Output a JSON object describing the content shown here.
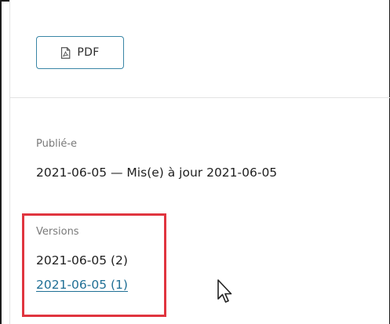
{
  "toolbar": {
    "pdf_label": "PDF",
    "pdf_icon": "pdf-document-icon"
  },
  "metadata": {
    "published_label": "Publié-e",
    "published_value": "2021-06-05 — Mis(e) à jour 2021-06-05",
    "versions_label": "Versions",
    "versions": [
      {
        "label": "2021-06-05 (2)",
        "is_link": false
      },
      {
        "label": "2021-06-05 (1)",
        "is_link": true
      }
    ]
  },
  "colors": {
    "accent": "#3a86a6",
    "link": "#1f6f95",
    "highlight": "#e0353f"
  },
  "cursor": "arrow-cursor-icon"
}
